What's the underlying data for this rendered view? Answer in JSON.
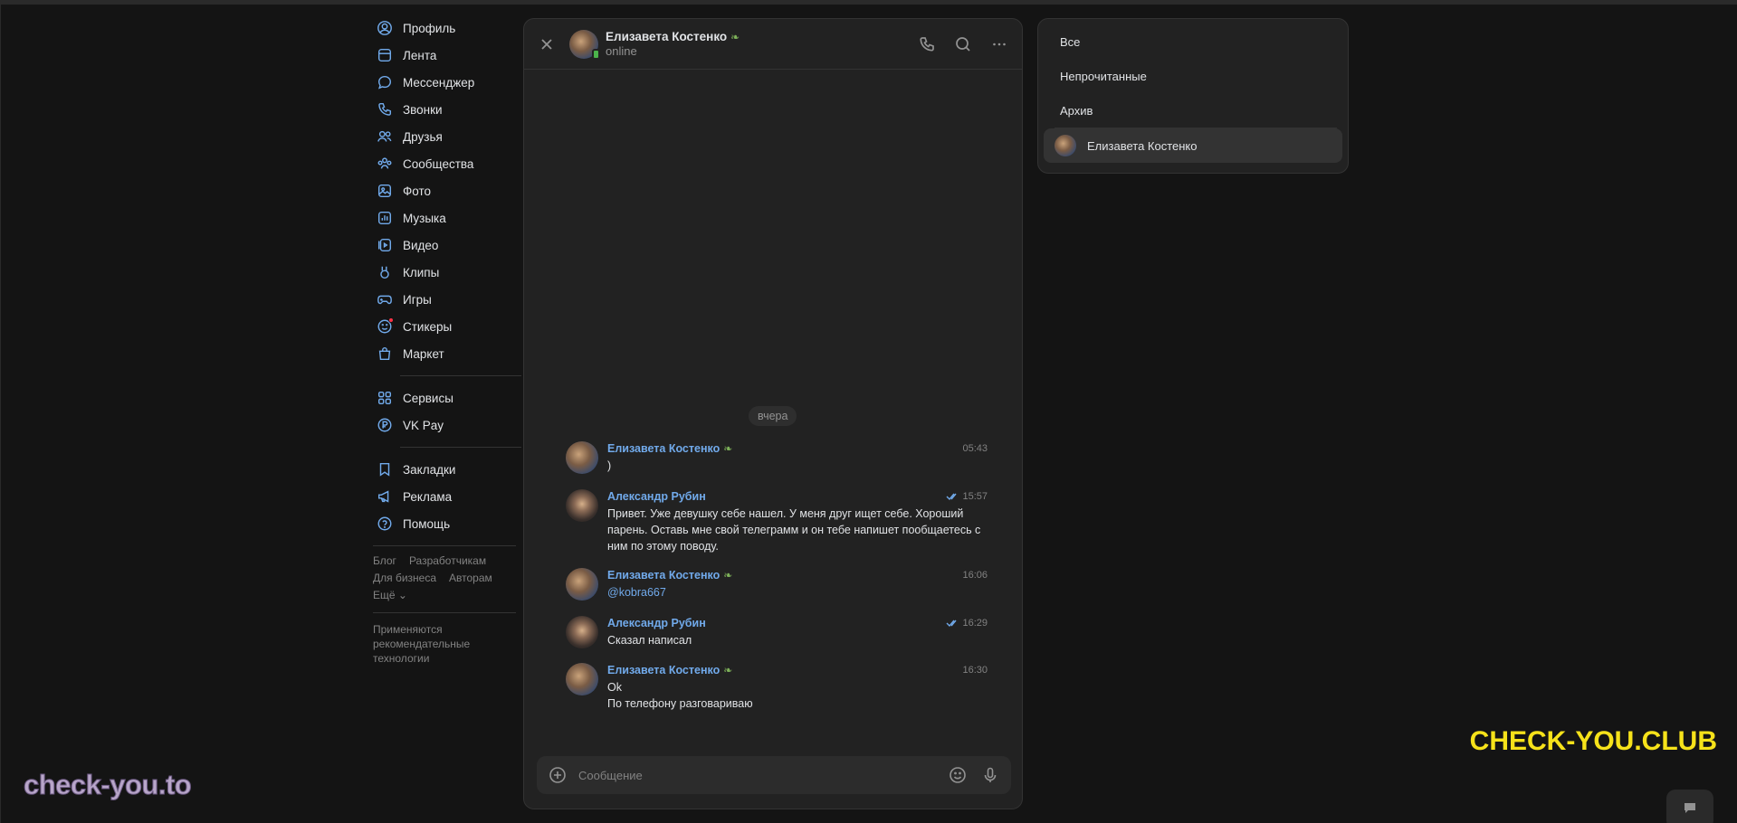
{
  "sidebar": {
    "items": [
      {
        "label": "Профиль",
        "icon": "profile-icon"
      },
      {
        "label": "Лента",
        "icon": "feed-icon"
      },
      {
        "label": "Мессенджер",
        "icon": "messenger-icon"
      },
      {
        "label": "Звонки",
        "icon": "phone-icon"
      },
      {
        "label": "Друзья",
        "icon": "friends-icon"
      },
      {
        "label": "Сообщества",
        "icon": "communities-icon"
      },
      {
        "label": "Фото",
        "icon": "photo-icon"
      },
      {
        "label": "Музыка",
        "icon": "music-icon"
      },
      {
        "label": "Видео",
        "icon": "video-icon"
      },
      {
        "label": "Клипы",
        "icon": "clips-icon"
      },
      {
        "label": "Игры",
        "icon": "games-icon"
      },
      {
        "label": "Стикеры",
        "icon": "stickers-icon"
      },
      {
        "label": "Маркет",
        "icon": "market-icon"
      }
    ],
    "extra": [
      {
        "label": "Сервисы",
        "icon": "services-icon"
      },
      {
        "label": "VK Pay",
        "icon": "vkpay-icon"
      }
    ],
    "more": [
      {
        "label": "Закладки",
        "icon": "bookmark-icon"
      },
      {
        "label": "Реклама",
        "icon": "ads-icon"
      },
      {
        "label": "Помощь",
        "icon": "help-icon"
      }
    ],
    "footer_links": [
      "Блог",
      "Разработчикам",
      "Для бизнеса",
      "Авторам"
    ],
    "footer_more": "Ещё ⌄",
    "rec_tech": "Применяются рекомендательные технологии"
  },
  "chat": {
    "name": "Елизавета Костенко",
    "status": "online",
    "day_label": "вчера",
    "composer_placeholder": "Сообщение",
    "messages": [
      {
        "author": "Елизавета Костенко",
        "time": "05:43",
        "text": ")",
        "read": false
      },
      {
        "author": "Александр Рубин",
        "time": "15:57",
        "text": "Привет. Уже девушку себе нашел. У меня друг ищет себе. Хороший парень. Оставь мне свой телеграмм и он тебе напишет пообщаетесь с ним по этому поводу.",
        "read": true
      },
      {
        "author": "Елизавета Костенко",
        "time": "16:06",
        "text": "@kobra667",
        "read": false
      },
      {
        "author": "Александр Рубин",
        "time": "16:29",
        "text": "Сказал написал",
        "read": true
      },
      {
        "author": "Елизавета Костенко",
        "time": "16:30",
        "text_lines": [
          "Ok",
          "По телефону разговариваю"
        ],
        "read": false
      }
    ]
  },
  "folders": {
    "items": [
      "Все",
      "Непрочитанные",
      "Архив"
    ],
    "active_chat": "Елизавета Костенко"
  },
  "watermarks": {
    "left": "check-you.to",
    "right": "CHECK-YOU.CLUB"
  },
  "colors": {
    "accent": "#71aaeb",
    "online": "#4bb34b",
    "background": "#141414",
    "panel": "#222222"
  }
}
